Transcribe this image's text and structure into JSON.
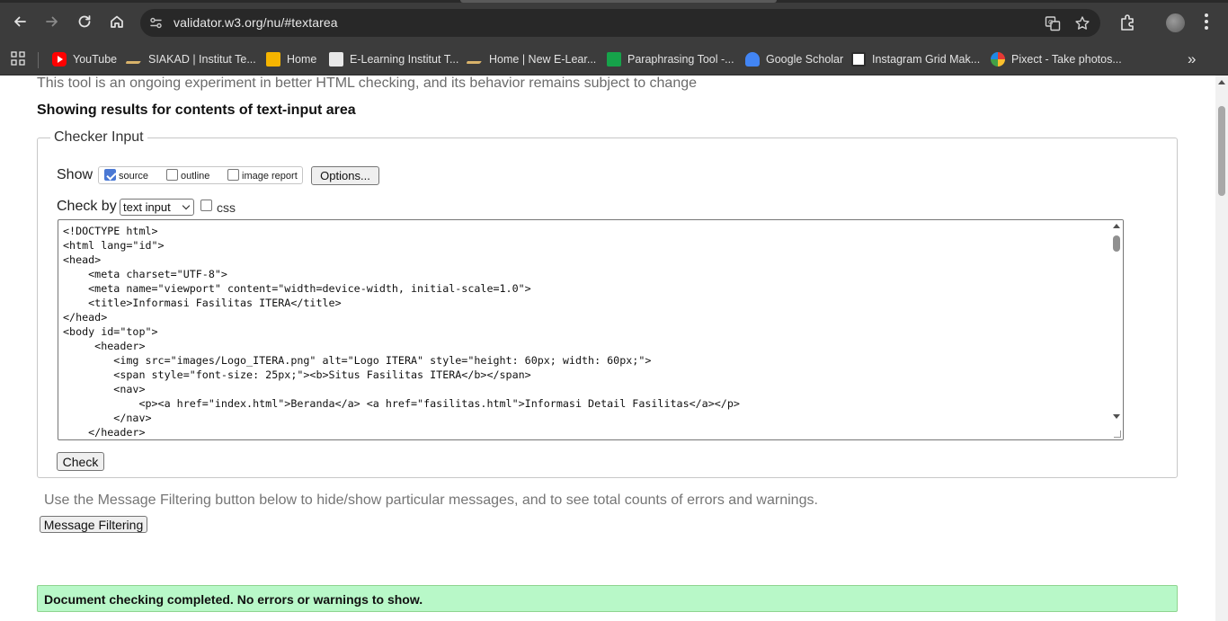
{
  "browser": {
    "url": "validator.w3.org/nu/#textarea"
  },
  "bookmarks": [
    {
      "label": "YouTube",
      "color": "#ff0000"
    },
    {
      "label": "SIAKAD | Institut Te...",
      "color": "#d8b26a"
    },
    {
      "label": "Home",
      "color": "#f5b400"
    },
    {
      "label": "E-Learning Institut T...",
      "color": "#e8e8e8"
    },
    {
      "label": "Home | New E-Lear...",
      "color": "#d8b26a"
    },
    {
      "label": "Paraphrasing Tool -...",
      "color": "#16a34a"
    },
    {
      "label": "Google Scholar",
      "color": "#4285f4"
    },
    {
      "label": "Instagram Grid Mak...",
      "color": "#ffffff"
    },
    {
      "label": "Pixect - Take photos...",
      "color": "#e53935"
    }
  ],
  "page": {
    "notice": "This tool is an ongoing experiment in better HTML checking, and its behavior remains subject to change",
    "results_heading": "Showing results for contents of text-input area",
    "checker": {
      "legend": "Checker Input",
      "show_label": "Show",
      "options": [
        {
          "label": "source",
          "checked": true
        },
        {
          "label": "outline",
          "checked": false
        },
        {
          "label": "image report",
          "checked": false
        }
      ],
      "options_button": "Options...",
      "check_by_label": "Check by",
      "check_by_value": "text input",
      "css_label": "css",
      "css_checked": false,
      "code": "<!DOCTYPE html>\n<html lang=\"id\">\n<head>\n    <meta charset=\"UTF-8\">\n    <meta name=\"viewport\" content=\"width=device-width, initial-scale=1.0\">\n    <title>Informasi Fasilitas ITERA</title>\n</head>\n<body id=\"top\">\n     <header>\n        <img src=\"images/Logo_ITERA.png\" alt=\"Logo ITERA\" style=\"height: 60px; width: 60px;\">\n        <span style=\"font-size: 25px;\"><b>Situs Fasilitas ITERA</b></span>\n        <nav>\n            <p><a href=\"index.html\">Beranda</a> <a href=\"fasilitas.html\">Informasi Detail Fasilitas</a></p>\n        </nav>\n    </header>",
      "check_button": "Check"
    },
    "filter_text": "Use the Message Filtering button below to hide/show particular messages, and to see total counts of errors and warnings.",
    "filter_button": "Message Filtering",
    "success_message": "Document checking completed. No errors or warnings to show."
  }
}
